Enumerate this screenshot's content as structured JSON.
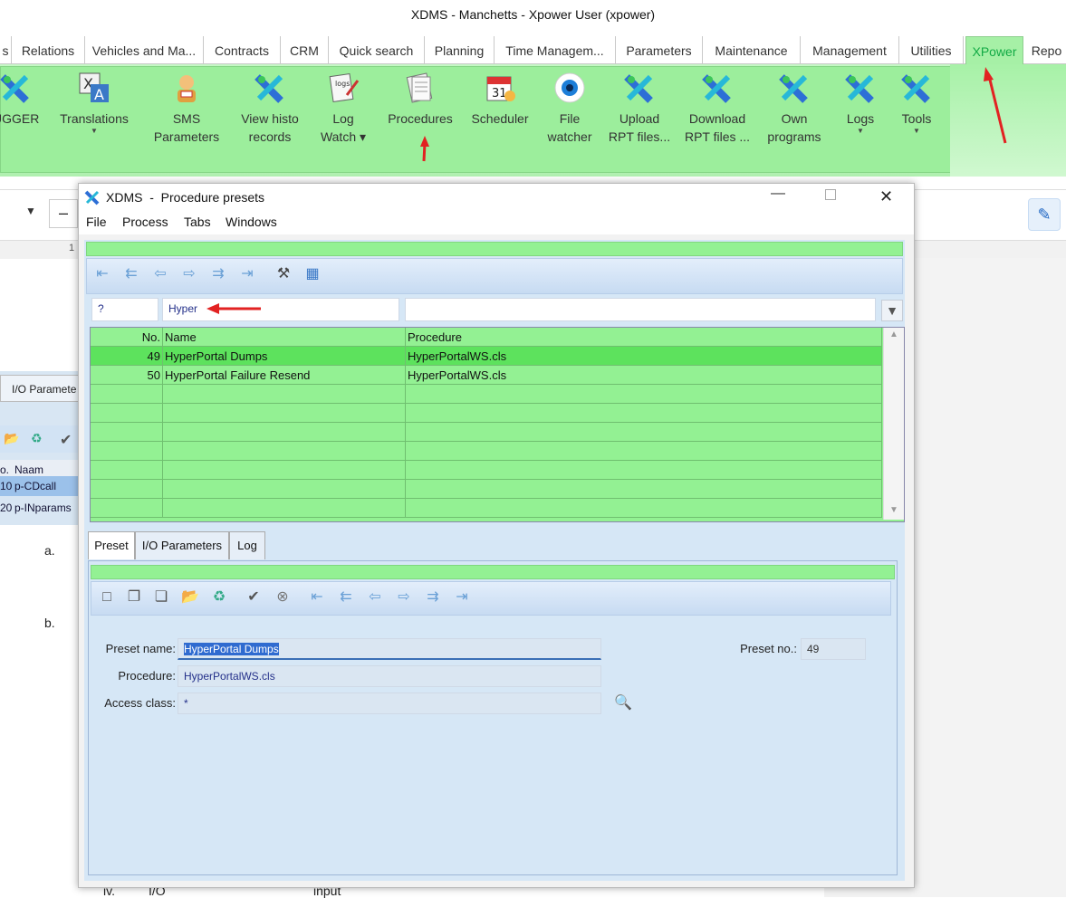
{
  "app": {
    "title": "XDMS - Manchetts - Xpower User (xpower)"
  },
  "menu_tabs": [
    {
      "label": "s",
      "active": false
    },
    {
      "label": "Relations",
      "active": false
    },
    {
      "label": "Vehicles and Ma...",
      "active": false
    },
    {
      "label": "Contracts",
      "active": false
    },
    {
      "label": "CRM",
      "active": false
    },
    {
      "label": "Quick search",
      "active": false
    },
    {
      "label": "Planning",
      "active": false
    },
    {
      "label": "Time Managem...",
      "active": false
    },
    {
      "label": "Parameters",
      "active": false
    },
    {
      "label": "Maintenance",
      "active": false
    },
    {
      "label": "Management",
      "active": false
    },
    {
      "label": "Utilities",
      "active": false
    },
    {
      "label": "XPower",
      "active": true
    },
    {
      "label": "Repo",
      "active": false
    }
  ],
  "ribbon": {
    "buttons": [
      {
        "line1": "UGGER",
        "line2": "",
        "caret": false,
        "icon": "xpower-icon"
      },
      {
        "line1": "Translations",
        "line2": "",
        "caret": true,
        "icon": "translate-icon"
      },
      {
        "line1": "SMS",
        "line2": "Parameters",
        "caret": false,
        "icon": "sms-user-icon"
      },
      {
        "line1": "View histo",
        "line2": "records",
        "caret": false,
        "icon": "xpower-icon"
      },
      {
        "line1": "Log",
        "line2": "Watch ▾",
        "caret": false,
        "icon": "logs-notepad-icon"
      },
      {
        "line1": "Procedures",
        "line2": "",
        "caret": false,
        "icon": "procedures-icon"
      },
      {
        "line1": "Scheduler",
        "line2": "",
        "caret": false,
        "icon": "calendar-icon"
      },
      {
        "line1": "File",
        "line2": "watcher",
        "caret": false,
        "icon": "eye-icon"
      },
      {
        "line1": "Upload",
        "line2": "RPT files...",
        "caret": false,
        "icon": "xpower-icon"
      },
      {
        "line1": "Download",
        "line2": "RPT files ...",
        "caret": false,
        "icon": "xpower-icon"
      },
      {
        "line1": "Own",
        "line2": "programs",
        "caret": false,
        "icon": "xpower-icon"
      },
      {
        "line1": "Logs",
        "line2": "",
        "caret": true,
        "icon": "xpower-icon"
      },
      {
        "line1": "Tools",
        "line2": "",
        "caret": true,
        "icon": "xpower-icon"
      }
    ]
  },
  "background": {
    "io_tab": "I/O Paramete",
    "col_no": "o.",
    "col_name": "Naam",
    "rows": [
      {
        "no": "10",
        "name": "p-CDcall"
      },
      {
        "no": "20",
        "name": "p-INparams"
      }
    ],
    "list_a": "a.",
    "list_b": "b.",
    "bottom_text1": "iv.",
    "bottom_text2": "I/O",
    "bottom_text3": "input",
    "ruler_mark": "1"
  },
  "window": {
    "title": "XDMS  -  Procedure presets",
    "menu": [
      "File",
      "Process",
      "Tabs",
      "Windows"
    ],
    "filter": {
      "no": "?",
      "name": "Hyper",
      "procedure": ""
    },
    "columns": {
      "no": "No.",
      "name": "Name",
      "procedure": "Procedure"
    },
    "rows": [
      {
        "no": "49",
        "name": "HyperPortal Dumps",
        "procedure": "HyperPortalWS.cls",
        "selected": true
      },
      {
        "no": "50",
        "name": "HyperPortal Failure Resend",
        "procedure": "HyperPortalWS.cls",
        "selected": false
      }
    ],
    "tabs": [
      {
        "label": "Preset",
        "active": true
      },
      {
        "label": "I/O Parameters",
        "active": false
      },
      {
        "label": "Log",
        "active": false
      }
    ],
    "detail": {
      "preset_name_label": "Preset name:",
      "preset_name": "HyperPortal Dumps",
      "procedure_label": "Procedure:",
      "procedure": "HyperPortalWS.cls",
      "access_label": "Access class:",
      "access": "*",
      "preset_no_label": "Preset no.:",
      "preset_no": "49"
    }
  },
  "colors": {
    "ribbon_green": "#9cee9c",
    "grid_green": "#93f193",
    "arrow_red": "#e22222"
  }
}
